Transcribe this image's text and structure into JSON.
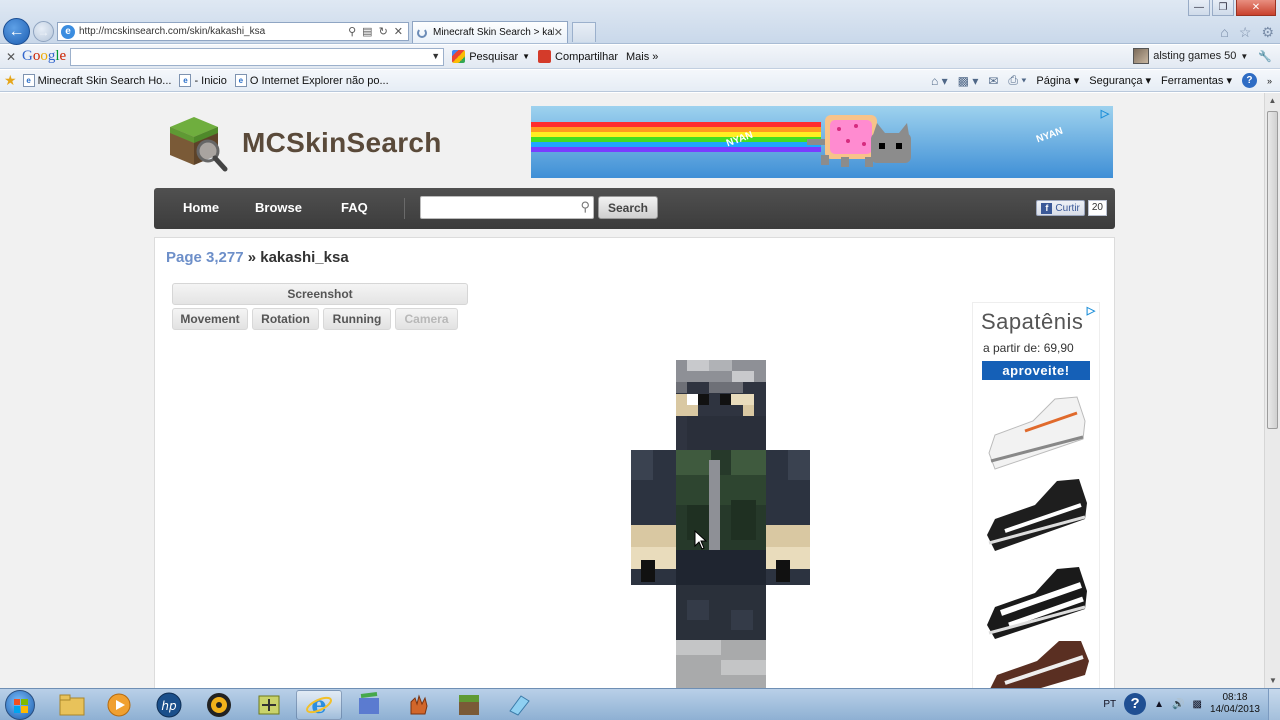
{
  "browser": {
    "url": "http://mcskinsearch.com/skin/kakashi_ksa",
    "active_tab_title": "Minecraft Skin Search > kak...",
    "google_toolbar": {
      "search_label": "Pesquisar",
      "share_label": "Compartilhar",
      "more_label": "Mais »",
      "user_label": "alsting games 50"
    },
    "favorites": [
      "Minecraft Skin Search  Ho...",
      "- Inicio",
      "O Internet Explorer não po..."
    ],
    "command_bar": {
      "page_label": "Página",
      "security_label": "Segurança",
      "tools_label": "Ferramentas"
    }
  },
  "site": {
    "name": "MCSkinSearch",
    "nav": {
      "home": "Home",
      "browse": "Browse",
      "faq": "FAQ",
      "search_button": "Search",
      "search_placeholder": ""
    },
    "like": {
      "label": "Curtir",
      "count": "20"
    },
    "breadcrumb": {
      "page_link": "Page 3,277",
      "separator": "»",
      "current": "kakashi_ksa"
    },
    "view_tabs": {
      "screenshot": "Screenshot",
      "movement": "Movement",
      "rotation": "Rotation",
      "running": "Running",
      "camera": "Camera"
    },
    "banner_ad": {
      "text1": "NYAN",
      "text2": "NYAN"
    },
    "side_ad": {
      "brand": "Sapatênis",
      "price": "a partir de: 69,90",
      "cta": "aproveite!"
    }
  },
  "taskbar": {
    "language": "PT",
    "time": "08:18",
    "date": "14/04/2013"
  },
  "colors": {
    "accent_blue": "#6d8fc9",
    "nav_dark": "#454545",
    "ad_blue": "#1560b7"
  }
}
